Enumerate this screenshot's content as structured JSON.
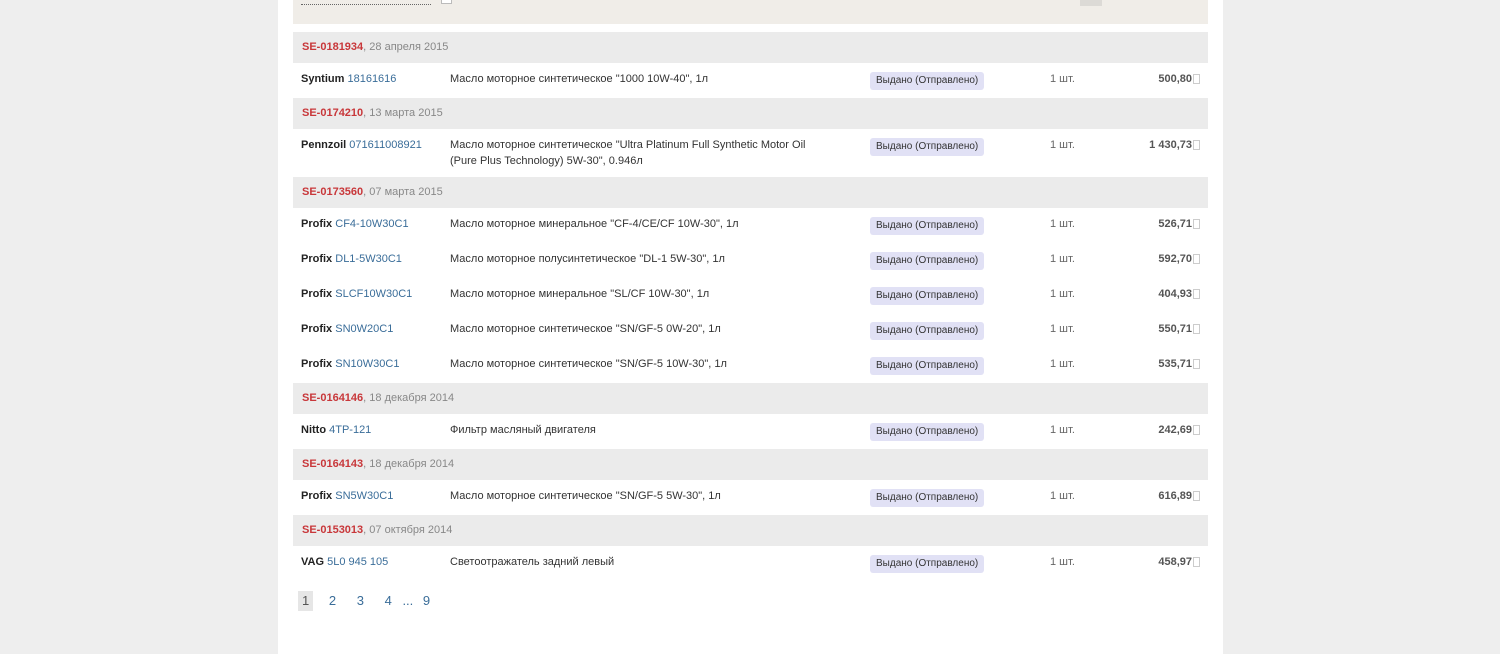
{
  "orders": [
    {
      "id": "SE-0181934",
      "date": ", 28 апреля 2015",
      "items": [
        {
          "brand": "Syntium",
          "article": "18161616",
          "description": "Масло моторное синтетическое \"1000 10W-40\", 1л",
          "status": "Выдано (Отправлено)",
          "qty": "1 шт.",
          "price": "500,80"
        }
      ]
    },
    {
      "id": "SE-0174210",
      "date": ", 13 марта 2015",
      "items": [
        {
          "brand": "Pennzoil",
          "article": "071611008921",
          "description": "Масло моторное синтетическое \"Ultra Platinum Full Synthetic Motor Oil (Pure Plus Technology) 5W-30\", 0.946л",
          "status": "Выдано (Отправлено)",
          "qty": "1 шт.",
          "price": "1 430,73"
        }
      ]
    },
    {
      "id": "SE-0173560",
      "date": ", 07 марта 2015",
      "items": [
        {
          "brand": "Profix",
          "article": "CF4-10W30C1",
          "description": "Масло моторное минеральное \"CF-4/CE/CF 10W-30\", 1л",
          "status": "Выдано (Отправлено)",
          "qty": "1 шт.",
          "price": "526,71"
        },
        {
          "brand": "Profix",
          "article": "DL1-5W30C1",
          "description": "Масло моторное полусинтетическое \"DL-1 5W-30\", 1л",
          "status": "Выдано (Отправлено)",
          "qty": "1 шт.",
          "price": "592,70"
        },
        {
          "brand": "Profix",
          "article": "SLCF10W30C1",
          "description": "Масло моторное минеральное \"SL/CF 10W-30\", 1л",
          "status": "Выдано (Отправлено)",
          "qty": "1 шт.",
          "price": "404,93"
        },
        {
          "brand": "Profix",
          "article": "SN0W20C1",
          "description": "Масло моторное синтетическое \"SN/GF-5 0W-20\", 1л",
          "status": "Выдано (Отправлено)",
          "qty": "1 шт.",
          "price": "550,71"
        },
        {
          "brand": "Profix",
          "article": "SN10W30C1",
          "description": "Масло моторное синтетическое \"SN/GF-5 10W-30\", 1л",
          "status": "Выдано (Отправлено)",
          "qty": "1 шт.",
          "price": "535,71"
        }
      ]
    },
    {
      "id": "SE-0164146",
      "date": ", 18 декабря 2014",
      "items": [
        {
          "brand": "Nitto",
          "article": "4TP-121",
          "description": "Фильтр масляный двигателя",
          "status": "Выдано (Отправлено)",
          "qty": "1 шт.",
          "price": "242,69"
        }
      ]
    },
    {
      "id": "SE-0164143",
      "date": ", 18 декабря 2014",
      "items": [
        {
          "brand": "Profix",
          "article": "SN5W30C1",
          "description": "Масло моторное синтетическое \"SN/GF-5 5W-30\", 1л",
          "status": "Выдано (Отправлено)",
          "qty": "1 шт.",
          "price": "616,89"
        }
      ]
    },
    {
      "id": "SE-0153013",
      "date": ", 07 октября 2014",
      "items": [
        {
          "brand": "VAG",
          "article": "5L0 945 105",
          "description": "Светоотражатель задний левый",
          "status": "Выдано (Отправлено)",
          "qty": "1 шт.",
          "price": "458,97"
        }
      ]
    }
  ],
  "pagination": {
    "current": "1",
    "pages": [
      "2",
      "3",
      "4"
    ],
    "ellipsis": "...",
    "last": "9"
  }
}
